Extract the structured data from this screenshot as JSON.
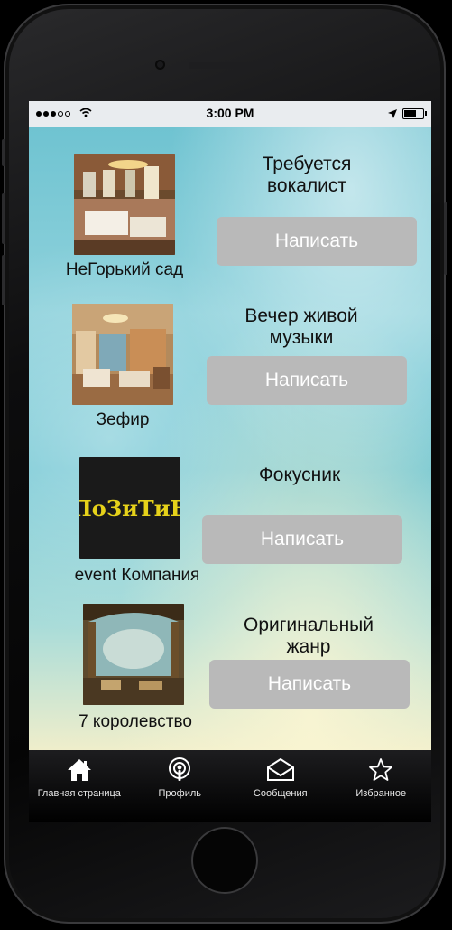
{
  "status_bar": {
    "time": "3:00 PM",
    "signal_dots_filled": 3,
    "signal_dots_total": 5,
    "battery_level": 0.7,
    "icons": [
      "signal-dots",
      "wifi-icon",
      "location-arrow-icon",
      "battery-icon"
    ]
  },
  "listings": [
    {
      "venue": "НеГорький сад",
      "title": "Требуется вокалист",
      "button": "Написать"
    },
    {
      "venue": "Зефир",
      "title": "Вечер живой музыки",
      "button": "Написать"
    },
    {
      "venue": "event Компания",
      "title": "Фокусник",
      "button": "Написать",
      "logo_text": "ПоЗиТиВ"
    },
    {
      "venue": "7 королевство",
      "title": "Оригинальный жанр",
      "button": "Написать"
    }
  ],
  "tabbar": [
    {
      "label": "Главная страница",
      "icon": "home-icon"
    },
    {
      "label": "Профиль",
      "icon": "profile-broadcast-icon"
    },
    {
      "label": "Сообщения",
      "icon": "envelope-icon"
    },
    {
      "label": "Избранное",
      "icon": "star-icon"
    }
  ],
  "colors": {
    "button_bg": "#b9b9b9",
    "tabbar_bg": "#0b0b0c",
    "logo_bg": "#1a1a1a",
    "logo_text": "#e6d21a"
  }
}
